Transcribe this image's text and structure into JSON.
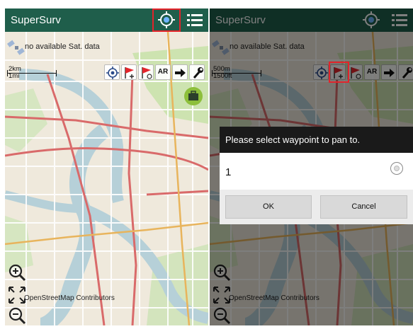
{
  "screens": [
    {
      "app_title": "SuperSurv",
      "sat_status": "no available Sat. data",
      "scale_top": "2km",
      "scale_bottom": "1mi",
      "toolbar": [
        "locate-icon",
        "add-waypoint-icon",
        "waypoint-target-icon",
        "AR",
        "navigate-icon",
        "wrench-icon"
      ],
      "ar_label": "AR",
      "attribution": "OpenStreetMap Contributors",
      "highlighted": "locate-button"
    },
    {
      "app_title": "SuperSurv",
      "sat_status": "no available Sat. data",
      "scale_top": "500m",
      "scale_bottom": "1500ft",
      "ar_label": "AR",
      "attribution": "OpenStreetMap Contributors",
      "highlighted": "add-waypoint-button",
      "dialog": {
        "title": "Please select waypoint to pan to.",
        "items": [
          "1"
        ],
        "ok_label": "OK",
        "cancel_label": "Cancel"
      }
    }
  ],
  "colors": {
    "appbar": "#1f5e4b",
    "highlight": "#e3242b",
    "river": "#b6d0d8",
    "land": "#f1ece0",
    "park": "#cde3b0",
    "major_road": "#d96a6a"
  }
}
